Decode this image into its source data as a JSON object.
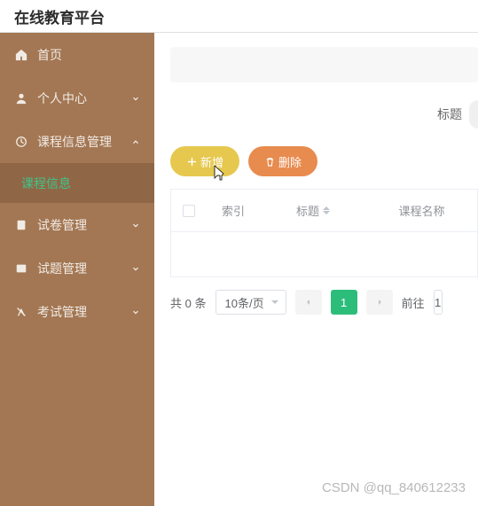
{
  "header": {
    "title": "在线教育平台"
  },
  "sidebar": {
    "items": [
      {
        "label": "首页",
        "icon": "home-icon",
        "hasChildren": false
      },
      {
        "label": "个人中心",
        "icon": "user-icon",
        "hasChildren": true
      },
      {
        "label": "课程信息管理",
        "icon": "clock-icon",
        "hasChildren": true,
        "expanded": true
      },
      {
        "label": "课程信息",
        "icon": "",
        "isSub": true,
        "active": true
      },
      {
        "label": "试卷管理",
        "icon": "paper-icon",
        "hasChildren": true
      },
      {
        "label": "试题管理",
        "icon": "question-icon",
        "hasChildren": true
      },
      {
        "label": "考试管理",
        "icon": "exam-icon",
        "hasChildren": true
      }
    ]
  },
  "search": {
    "label": "标题"
  },
  "actions": {
    "add_label": "新增",
    "delete_label": "删除"
  },
  "table": {
    "columns": {
      "index": "索引",
      "title": "标题",
      "course_name": "课程名称"
    },
    "rows": []
  },
  "pagination": {
    "total_prefix": "共",
    "total_count": "0",
    "total_suffix": "条",
    "page_size": "10条/页",
    "current": "1",
    "jump_label": "前往",
    "jump_value": "1"
  },
  "watermark": "CSDN @qq_840612233"
}
